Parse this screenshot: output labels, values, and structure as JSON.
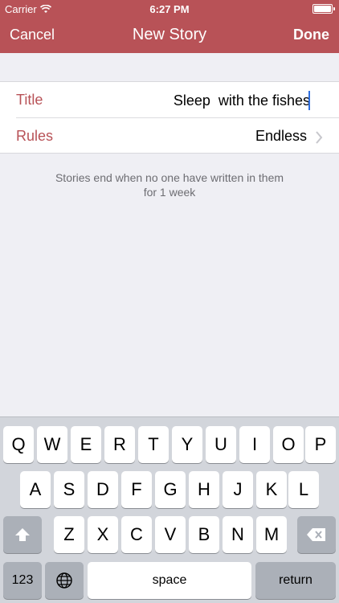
{
  "status_bar": {
    "carrier": "Carrier",
    "time": "6:27 PM",
    "wifi_icon": "wifi-icon",
    "battery_icon": "battery-icon"
  },
  "nav": {
    "cancel_label": "Cancel",
    "title": "New Story",
    "done_label": "Done"
  },
  "form": {
    "title_label": "Title",
    "title_value": "Sleep  with the fishes",
    "rules_label": "Rules",
    "rules_value": "Endless",
    "chevron_icon": "chevron-right-icon"
  },
  "footnote": "Stories end when no one have written in them for 1 week",
  "keyboard": {
    "row1": [
      "Q",
      "W",
      "E",
      "R",
      "T",
      "Y",
      "U",
      "I",
      "O",
      "P"
    ],
    "row2": [
      "A",
      "S",
      "D",
      "F",
      "G",
      "H",
      "J",
      "K",
      "L"
    ],
    "row3": [
      "Z",
      "X",
      "C",
      "V",
      "B",
      "N",
      "M"
    ],
    "numbers_label": "123",
    "space_label": "space",
    "return_label": "return",
    "shift_icon": "shift-icon",
    "backspace_icon": "backspace-icon",
    "globe_icon": "globe-icon"
  },
  "colors": {
    "accent": "#b85257",
    "background": "#efeff4",
    "keyboard_bg": "#d2d5db",
    "caret": "#2f6fe0"
  }
}
